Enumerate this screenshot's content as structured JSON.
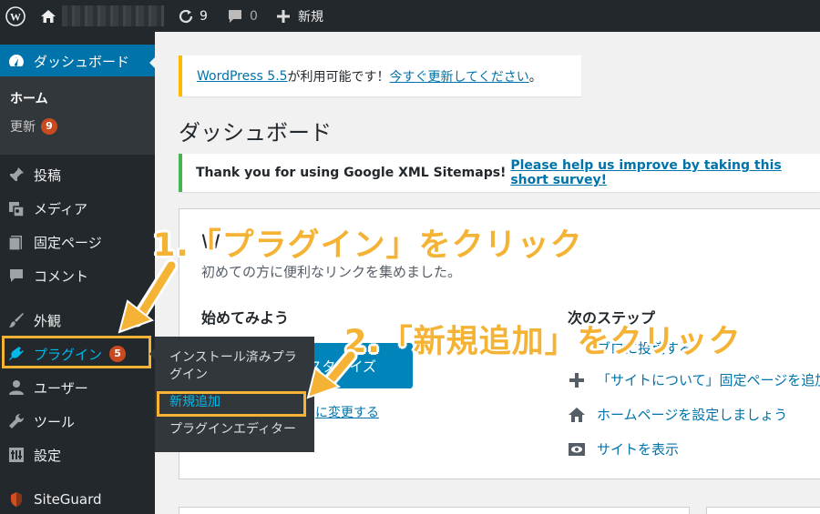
{
  "adminbar": {
    "wp_logo_icon": "wordpress-icon",
    "home_icon": "home-icon",
    "updates_count": "9",
    "comments_count": "0",
    "new_label": "新規"
  },
  "sidebar": {
    "dashboard": "ダッシュボード",
    "home": "ホーム",
    "updates": "更新",
    "updates_badge": "9",
    "posts": "投稿",
    "media": "メディア",
    "pages": "固定ページ",
    "comments": "コメント",
    "appearance": "外観",
    "plugins": "プラグイン",
    "plugins_badge": "5",
    "users": "ユーザー",
    "tools": "ツール",
    "settings": "設定",
    "siteguard": "SiteGuard"
  },
  "flyout": {
    "installed_line1": "インストール済みプラ",
    "installed_line2": "グイン",
    "add_new": "新規追加",
    "editor": "プラグインエディター"
  },
  "notices": {
    "update_link": "WordPress 5.5",
    "update_text": " が利用可能です！",
    "update_now": "今すぐ更新してください",
    "update_end": "。",
    "sitemaps_text": "Thank you for using Google XML Sitemaps! ",
    "sitemaps_link": "Please help us improve by taking this short survey!"
  },
  "page_title": "ダッシュボード",
  "welcome": {
    "heading_partial": "W",
    "subtitle": "初めての方に便利なリンクを集めました。",
    "get_started": "始めてみよう",
    "customize_btn_partial": "スタマイズ",
    "change_theme_partial": "に変更する",
    "next_steps": "次のステップ",
    "step1_partial": "ブロ",
    "step1_tail": "に投稿する",
    "step2": "「サイトについて」固定ページを追加",
    "step3": "ホームページを設定しましょう",
    "step4": "サイトを表示"
  },
  "callouts": {
    "step1": "1.「プラグイン」をクリック",
    "step2": "2.「新規追加」をクリック"
  },
  "colors": {
    "admin_bg": "#23282d",
    "submenu_bg": "#32373c",
    "active_blue": "#0073aa",
    "badge": "#ca4a1f",
    "highlight": "#f5b335",
    "notice_warning": "#ffb900",
    "notice_success": "#46b450"
  }
}
